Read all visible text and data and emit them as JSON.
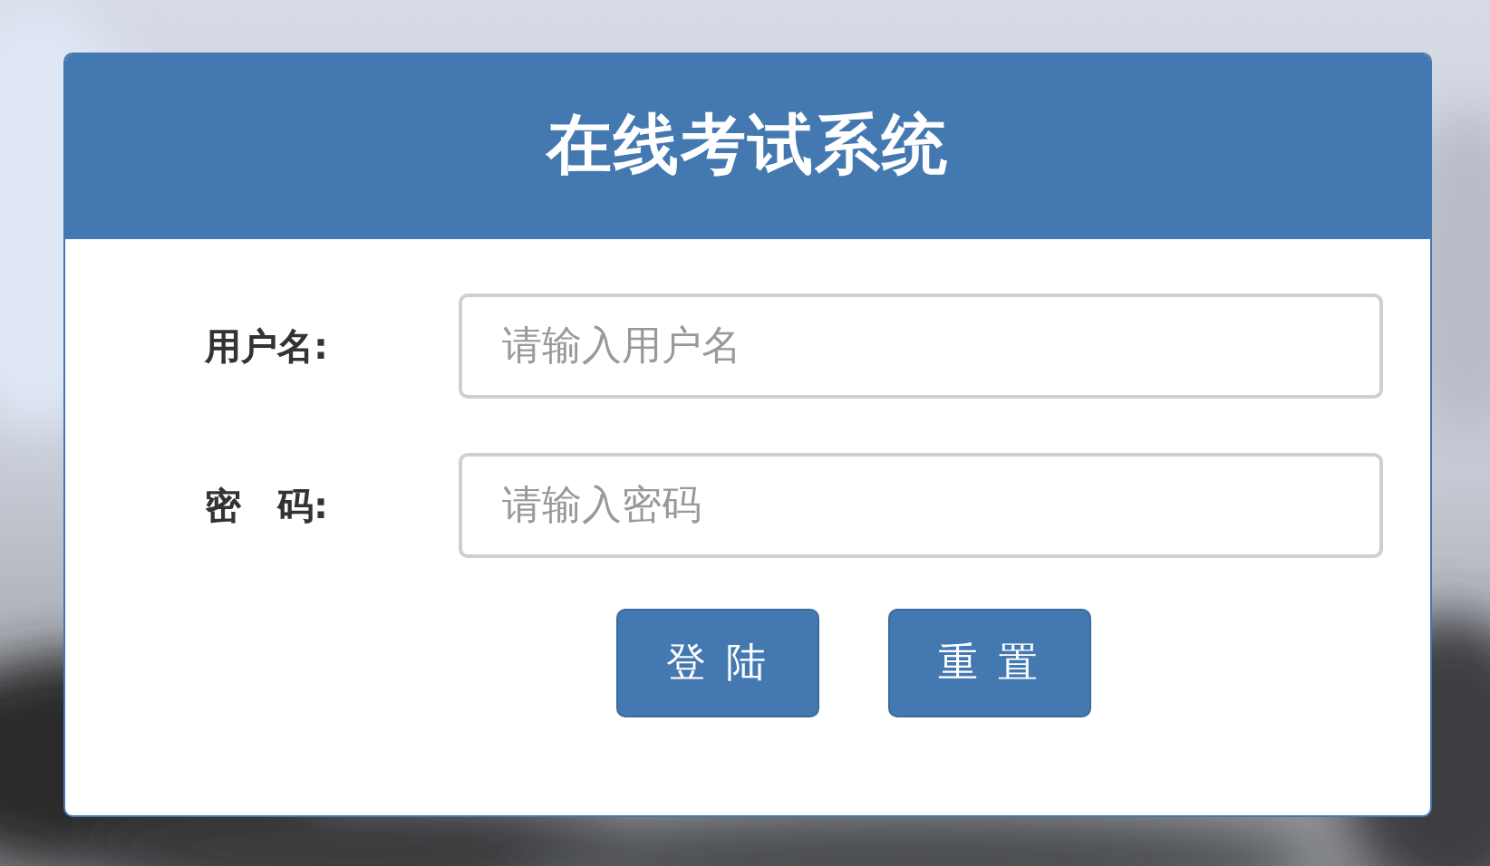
{
  "title": "在线考试系统",
  "fields": [
    {
      "label": "用户名:",
      "placeholder": "请输入用户名"
    },
    {
      "label": "密　码:",
      "placeholder": "请输入密码"
    }
  ],
  "buttons": [
    "登 陆",
    "重 置"
  ]
}
